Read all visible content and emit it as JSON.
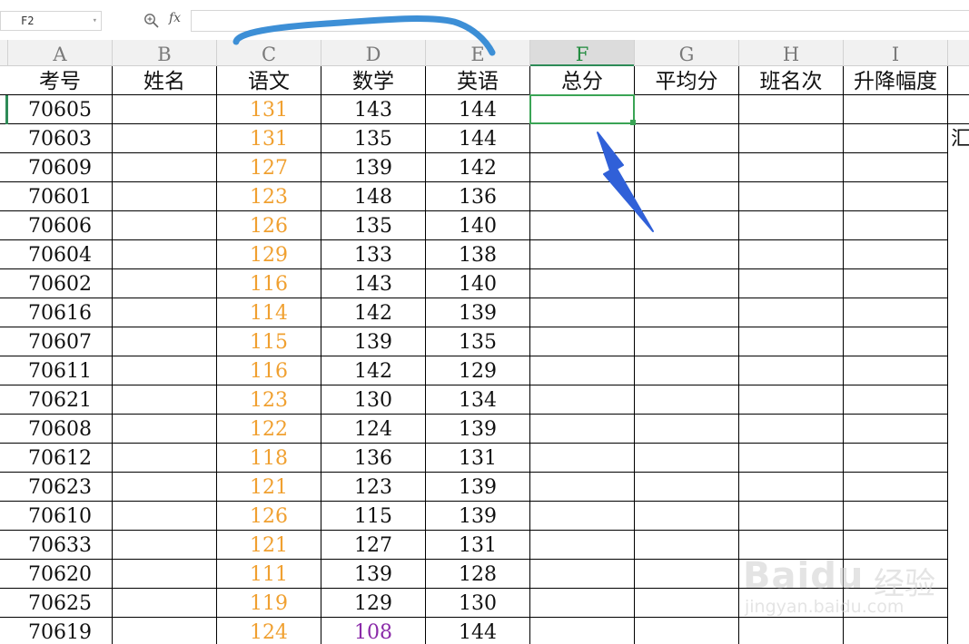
{
  "formula_bar": {
    "cell_ref": "F2",
    "fx_label": "fx",
    "formula_value": ""
  },
  "columns": [
    "A",
    "B",
    "C",
    "D",
    "E",
    "F",
    "G",
    "H",
    "I"
  ],
  "selected_column": "F",
  "header_row": [
    "考号",
    "姓名",
    "语文",
    "数学",
    "英语",
    "总分",
    "平均分",
    "班名次",
    "升降幅度"
  ],
  "rows": [
    {
      "id": "70605",
      "chinese": "131",
      "math": "143",
      "english": "144"
    },
    {
      "id": "70603",
      "chinese": "131",
      "math": "135",
      "english": "144"
    },
    {
      "id": "70609",
      "chinese": "127",
      "math": "139",
      "english": "142"
    },
    {
      "id": "70601",
      "chinese": "123",
      "math": "148",
      "english": "136"
    },
    {
      "id": "70606",
      "chinese": "126",
      "math": "135",
      "english": "140"
    },
    {
      "id": "70604",
      "chinese": "129",
      "math": "133",
      "english": "138"
    },
    {
      "id": "70602",
      "chinese": "116",
      "math": "143",
      "english": "140"
    },
    {
      "id": "70616",
      "chinese": "114",
      "math": "142",
      "english": "139"
    },
    {
      "id": "70607",
      "chinese": "115",
      "math": "139",
      "english": "135"
    },
    {
      "id": "70611",
      "chinese": "116",
      "math": "142",
      "english": "129"
    },
    {
      "id": "70621",
      "chinese": "123",
      "math": "130",
      "english": "134"
    },
    {
      "id": "70608",
      "chinese": "122",
      "math": "124",
      "english": "139"
    },
    {
      "id": "70612",
      "chinese": "118",
      "math": "136",
      "english": "131"
    },
    {
      "id": "70623",
      "chinese": "121",
      "math": "123",
      "english": "139"
    },
    {
      "id": "70610",
      "chinese": "126",
      "math": "115",
      "english": "139"
    },
    {
      "id": "70633",
      "chinese": "121",
      "math": "127",
      "english": "131"
    },
    {
      "id": "70620",
      "chinese": "111",
      "math": "139",
      "english": "128"
    },
    {
      "id": "70625",
      "chinese": "119",
      "math": "129",
      "english": "130"
    },
    {
      "id": "70619",
      "chinese": "124",
      "math": "108",
      "english": "144",
      "math_color": "purple"
    }
  ],
  "overflow_text": "汇",
  "colors": {
    "chinese_text": "#f0a030",
    "low_score_text": "#8a2aa8",
    "selection": "#3aa455",
    "annotation_line": "#3d8fd6",
    "annotation_arrow": "#3060d8"
  },
  "watermark": {
    "logo": "Baidu",
    "cn": "经验",
    "url": "jingyan.baidu.com"
  }
}
